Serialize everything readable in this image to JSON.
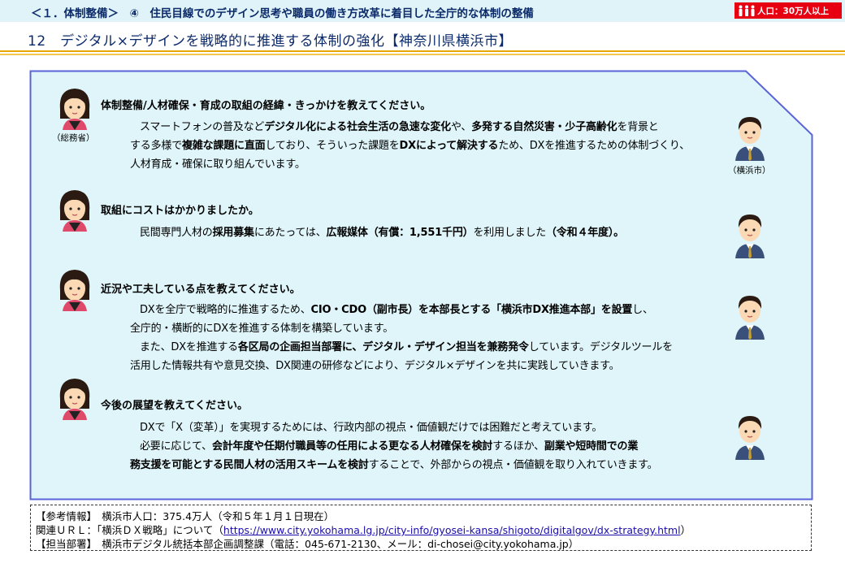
{
  "header": {
    "section_text": "＜１．体制整備＞　④　住民目線でのデザイン思考や職員の働き方改革に着目した全庁的な体制の整備",
    "population_badge": "人口：30万人以上",
    "badge_color": "#e60012"
  },
  "title": "12　デジタル×デザインを戦略的に推進する体制の強化【神奈川県横浜市】",
  "captions": {
    "ministry": "（総務省）",
    "city": "（横浜市）"
  },
  "qa": [
    {
      "question": "体制整備/人材確保・育成の取組の経緯・きっかけを教えてください。",
      "lines": [
        [
          "スマートフォンの普及など",
          "デジタル化による社会生活の急速な変化",
          "や、",
          "多発する自然災害・少子高齢化",
          "を背景と"
        ],
        [
          "する多様で",
          "複雑な課題に直面",
          "しており、そういった課題を",
          "DXによって解決する",
          "ため、DXを推進するための体制づくり、"
        ],
        [
          "人材育成・確保に取り組んでいます。"
        ]
      ]
    },
    {
      "question": "取組にコストはかかりましたか。",
      "lines": [
        [
          "民間専門人材の",
          "採用募集",
          "にあたっては、",
          "広報媒体（有償：1,551千円）",
          "を利用しました",
          "（令和４年度）。"
        ]
      ]
    },
    {
      "question": "近況や工夫している点を教えてください。",
      "lines": [
        [
          "DXを全庁で戦略的に推進するため、",
          "CIO・CDO（副市長）を本部長とする「横浜市DX推進本部」を設置",
          "し、"
        ],
        [
          "全庁的・横断的にDXを推進する体制を構築しています。"
        ],
        [
          "また、DXを推進する",
          "各区局の企画担当部署に、デジタル・デザイン担当を兼務発令",
          "しています。デジタルツールを"
        ],
        [
          "活用した情報共有や意見交換、DX関連の研修などにより、デジタル×デザインを共に実践していきます。"
        ]
      ]
    },
    {
      "question": "今後の展望を教えてください。",
      "lines": [
        [
          "DXで「X（変革）」を実現するためには、行政内部の視点・価値観だけでは困難だと考えています。"
        ],
        [
          "必要に応じて、",
          "会計年度や任期付職員等の任用による更なる人材確保を検討",
          "するほか、",
          "副業や短時間での業"
        ],
        [
          "務支援を可能とする民間人材の活用スキームを検討",
          "することで、外部からの視点・価値観を取り入れていきます。"
        ]
      ]
    }
  ],
  "footer": {
    "ref_label": "【参考情報】",
    "ref_text": "横浜市人口：375.4万人（令和５年１月１日現在）",
    "url_prefix": "関連ＵＲＬ：「横浜ＤＸ戦略」について（",
    "url": "https://www.city.yokohama.lg.jp/city-info/gyosei-kansa/shigoto/digitalgov/dx-strategy.html",
    "url_suffix": "）",
    "dept_label": "【担当部署】",
    "dept_text": "横浜市デジタル統括本部企画調整課（電話：045-671-2130、メール：di-chosei@city.yokohama.jp）"
  },
  "colors": {
    "panel_fill": "#dff5f9",
    "panel_border": "#5a63d8",
    "banner_fill": "#dff3f8",
    "title_color": "#0b2a6a",
    "rule_color": "#e8a600"
  }
}
